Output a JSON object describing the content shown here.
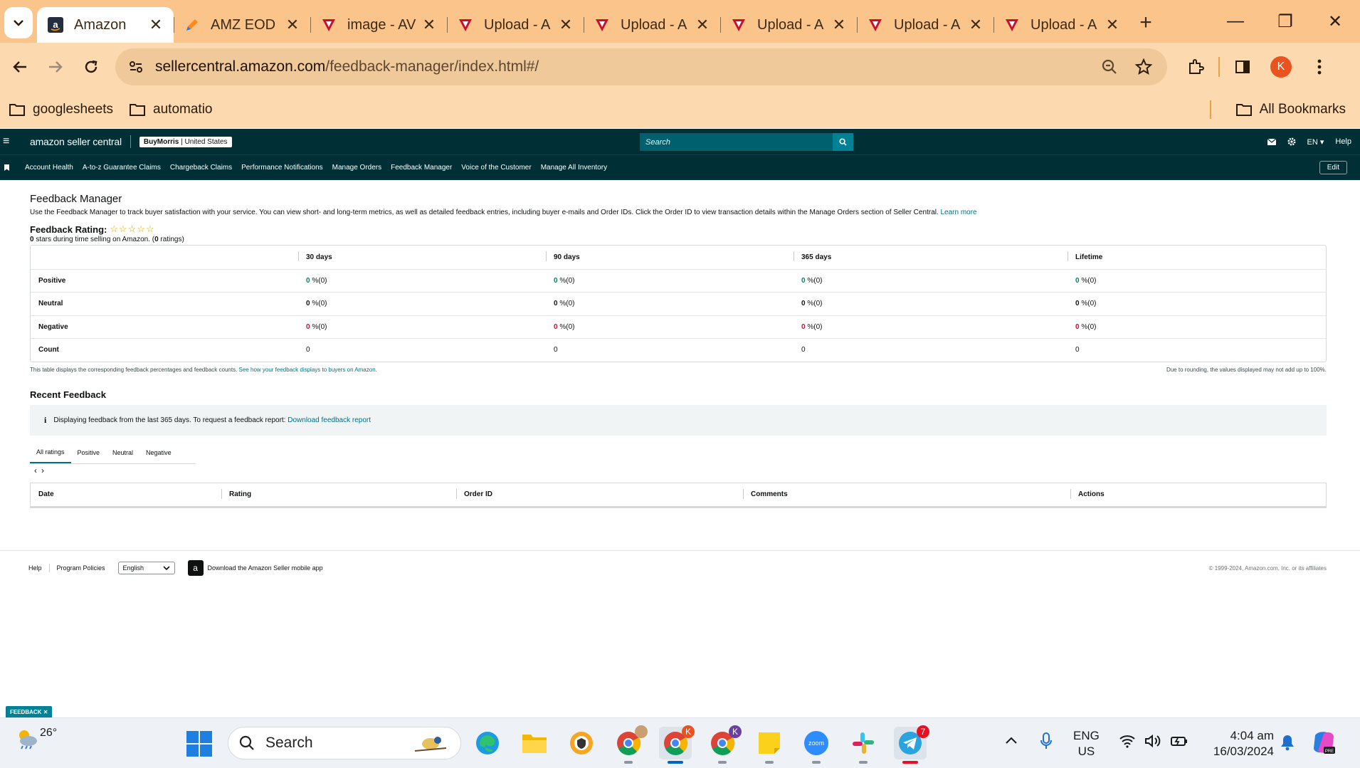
{
  "browser": {
    "tabs": [
      {
        "title": "Amazon",
        "active": true,
        "icon": "amazon-icon"
      },
      {
        "title": "AMZ EOD",
        "active": false,
        "icon": "pencil-icon"
      },
      {
        "title": "image - AV",
        "active": false,
        "icon": "app-logo-icon"
      },
      {
        "title": "Upload - A",
        "active": false,
        "icon": "app-logo-icon"
      },
      {
        "title": "Upload - A",
        "active": false,
        "icon": "app-logo-icon"
      },
      {
        "title": "Upload - A",
        "active": false,
        "icon": "app-logo-icon"
      },
      {
        "title": "Upload - A",
        "active": false,
        "icon": "app-logo-icon"
      },
      {
        "title": "Upload - A",
        "active": false,
        "icon": "app-logo-icon"
      }
    ],
    "url_host": "sellercentral.amazon.com",
    "url_path": "/feedback-manager/index.html#/",
    "profile_initial": "K",
    "bookmarks": [
      "googlesheets",
      "automatio"
    ],
    "all_bookmarks": "All Bookmarks"
  },
  "header": {
    "logo_text": "amazon seller central",
    "store_name": "BuyMorris",
    "store_region": "United States",
    "search_placeholder": "Search",
    "language": "EN",
    "help": "Help"
  },
  "nav": {
    "items": [
      "Account Health",
      "A-to-z Guarantee Claims",
      "Chargeback Claims",
      "Performance Notifications",
      "Manage Orders",
      "Feedback Manager",
      "Voice of the Customer",
      "Manage All Inventory"
    ],
    "edit": "Edit"
  },
  "page": {
    "title": "Feedback Manager",
    "description": "Use the Feedback Manager to track buyer satisfaction with your service. You can view short- and long-term metrics, as well as detailed feedback entries, including buyer e-mails and Order IDs. Click the Order ID to view transaction details within the Manage Orders section of Seller Central.",
    "learn_more": "Learn more",
    "rating_label": "Feedback Rating:",
    "stars": "☆☆☆☆☆",
    "rating_stars_value": "0",
    "rating_sub_mid": " stars during time selling on Amazon. (",
    "rating_count": "0",
    "rating_sub_end": " ratings)"
  },
  "feedback_table": {
    "columns": [
      "30 days",
      "90 days",
      "365 days",
      "Lifetime"
    ],
    "rows": [
      {
        "label": "Positive",
        "values": [
          "0",
          "0",
          "0",
          "0"
        ],
        "suffix": " %(0)",
        "tone": "positive"
      },
      {
        "label": "Neutral",
        "values": [
          "0",
          "0",
          "0",
          "0"
        ],
        "suffix": " %(0)",
        "tone": "neutral"
      },
      {
        "label": "Negative",
        "values": [
          "0",
          "0",
          "0",
          "0"
        ],
        "suffix": " %(0)",
        "tone": "negative"
      },
      {
        "label": "Count",
        "values": [
          "0",
          "0",
          "0",
          "0"
        ],
        "suffix": "",
        "tone": "count"
      }
    ],
    "note_left": "This table displays the corresponding feedback percentages and feedback counts.",
    "note_link": "See how your feedback displays to buyers on Amazon.",
    "note_right": "Due to rounding, the values displayed may not add up to 100%."
  },
  "recent": {
    "title": "Recent Feedback",
    "info_text": "Displaying feedback from the last 365 days. To request a feedback report:",
    "info_link": "Download feedback report",
    "filter_tabs": [
      "All ratings",
      "Positive",
      "Neutral",
      "Negative"
    ],
    "pager_prev": "‹",
    "pager_next": "›",
    "columns": [
      "Date",
      "Rating",
      "Order ID",
      "Comments",
      "Actions"
    ]
  },
  "footer": {
    "help": "Help",
    "policies": "Program Policies",
    "language": "English",
    "app_text": "Download the Amazon Seller mobile app",
    "copyright": "© 1999-2024, Amazon.com, Inc. or its affiliates"
  },
  "feedback_tag": "FEEDBACK",
  "taskbar": {
    "weather_temp": "26°",
    "search_label": "Search",
    "chrome_badge_1": "K",
    "chrome_badge_2": "K",
    "telegram_badge": "7",
    "lang_top": "ENG",
    "lang_bottom": "US",
    "time": "4:04 am",
    "date": "16/03/2024"
  },
  "colors": {
    "tabbar": "#fbc48a",
    "seller_header": "#002f36",
    "link": "#007185",
    "positive": "#067d62",
    "negative": "#cc0c39"
  }
}
